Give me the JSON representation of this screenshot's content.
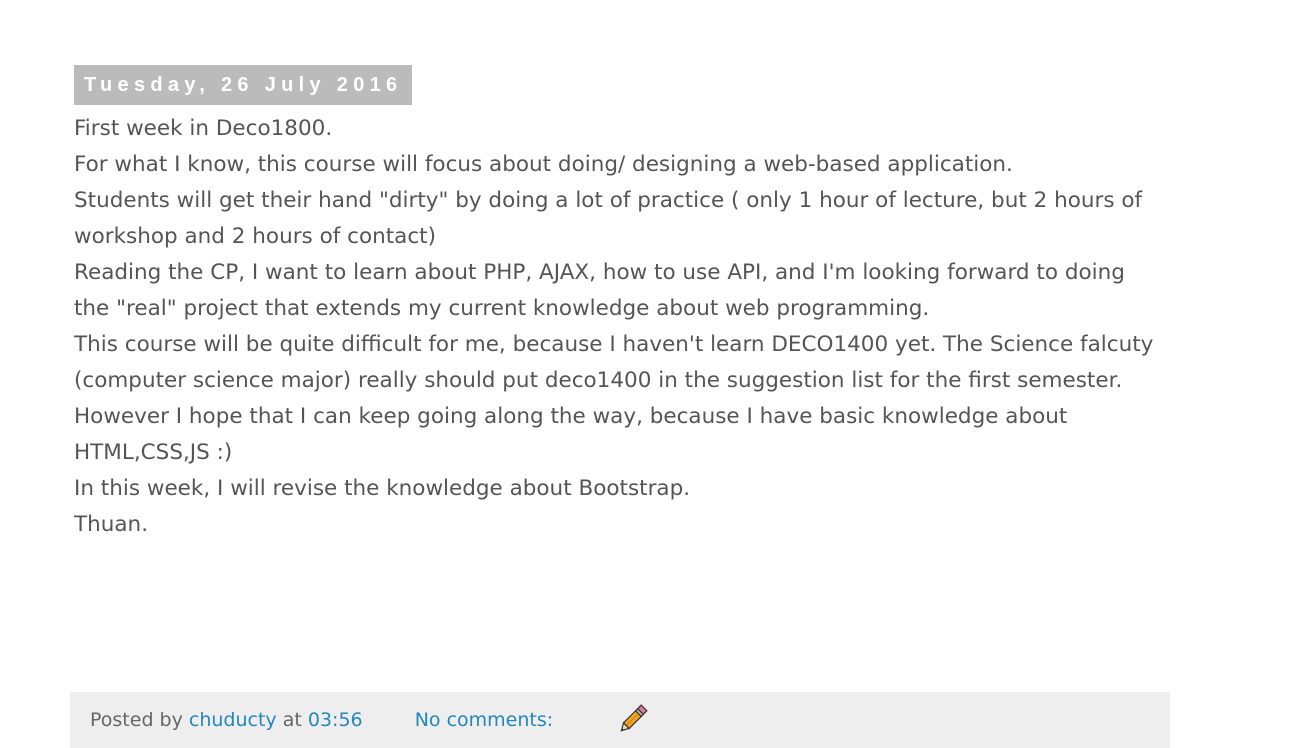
{
  "post": {
    "date": "Tuesday, 26 July 2016",
    "lines": [
      "First week in Deco1800.",
      "For what I know, this course will focus about doing/ designing a web-based application.",
      "Students will get their hand \"dirty\" by doing a lot of practice ( only 1 hour of lecture, but 2 hours of workshop and 2 hours of contact)",
      "Reading the CP, I want to learn about PHP, AJAX, how to use API, and I'm looking forward to doing the \"real\" project that extends my current knowledge about web programming.",
      "This course will be quite difficult for me, because I haven't learn DECO1400 yet. The Science falcuty (computer science major) really should put deco1400 in the suggestion list for the first semester. However I hope that I can keep going along the way, because I have basic knowledge about HTML,CSS,JS :)",
      "In this week, I will revise the knowledge about Bootstrap.",
      "Thuan."
    ]
  },
  "footer": {
    "posted_by_label": "Posted by",
    "author": "chuducty",
    "at_label": "at",
    "time": "03:56",
    "comments": "No comments:",
    "edit_icon": "pencil-icon"
  },
  "colors": {
    "date_header_bg": "#bbbbbb",
    "body_text": "#555555",
    "link": "#2288bb",
    "footer_bg": "#eeeeee"
  }
}
